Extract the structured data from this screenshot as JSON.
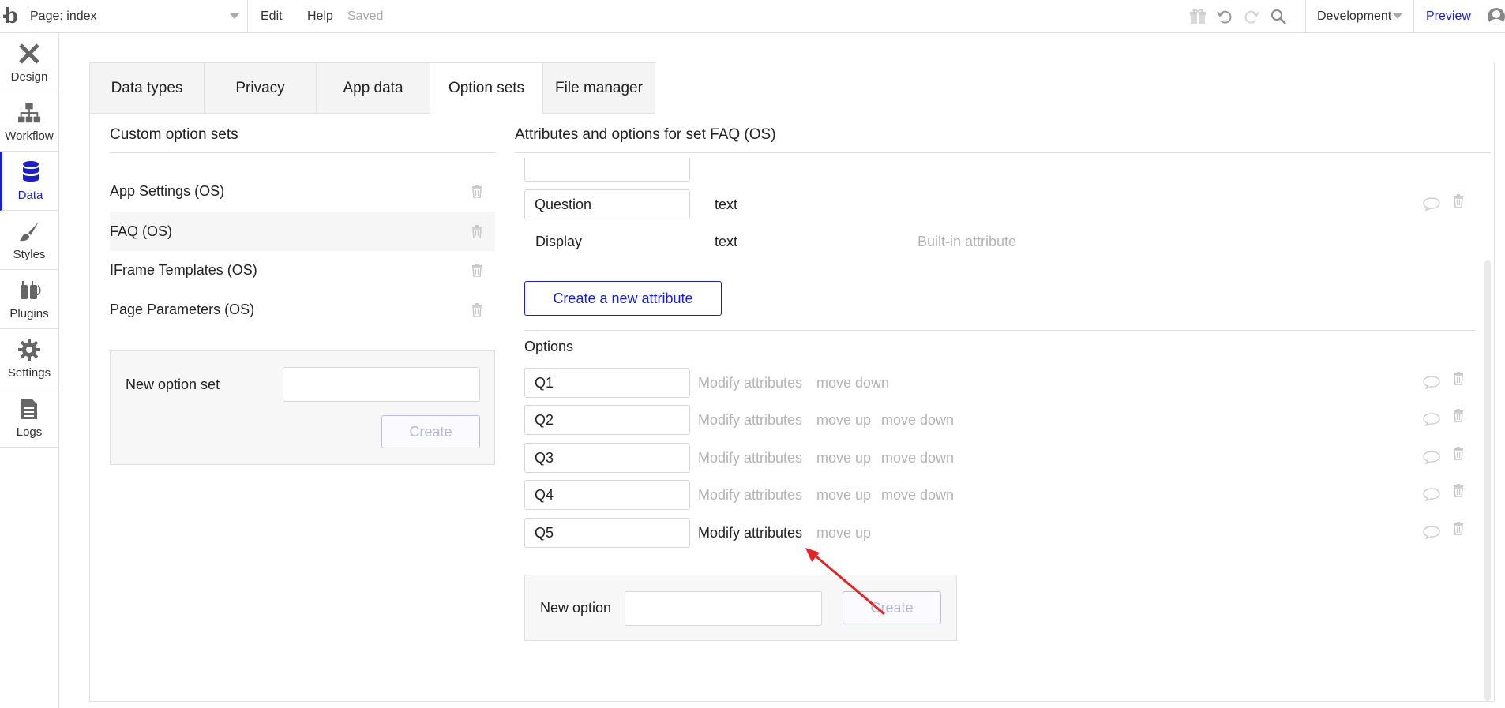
{
  "topbar": {
    "page_label": "Page: index",
    "menu": [
      "Edit",
      "Help"
    ],
    "status": "Saved",
    "environment": "Development",
    "preview": "Preview"
  },
  "sidebar": {
    "items": [
      {
        "label": "Design",
        "icon": "design-icon"
      },
      {
        "label": "Workflow",
        "icon": "workflow-icon"
      },
      {
        "label": "Data",
        "icon": "database-icon",
        "active": true
      },
      {
        "label": "Styles",
        "icon": "brush-icon"
      },
      {
        "label": "Plugins",
        "icon": "plug-icon"
      },
      {
        "label": "Settings",
        "icon": "gear-icon"
      },
      {
        "label": "Logs",
        "icon": "document-icon"
      }
    ]
  },
  "tabs": [
    "Data types",
    "Privacy",
    "App data",
    "Option sets",
    "File manager"
  ],
  "active_tab": "Option sets",
  "left": {
    "title": "Custom option sets",
    "sets": [
      "App Settings (OS)",
      "FAQ (OS)",
      "IFrame Templates (OS)",
      "Page Parameters (OS)"
    ],
    "selected": "FAQ (OS)",
    "new_label": "New option set",
    "create": "Create"
  },
  "right": {
    "title": "Attributes and options for set FAQ (OS)",
    "attributes": [
      {
        "name": "Question",
        "type": "text",
        "note": ""
      },
      {
        "name": "Display",
        "type": "text",
        "note": "Built-in attribute"
      }
    ],
    "create_attribute": "Create a new attribute",
    "options_title": "Options",
    "options": [
      {
        "name": "Q1",
        "modify": "Modify attributes",
        "up": "",
        "down": "move down"
      },
      {
        "name": "Q2",
        "modify": "Modify attributes",
        "up": "move up",
        "down": "move down"
      },
      {
        "name": "Q3",
        "modify": "Modify attributes",
        "up": "move up",
        "down": "move down"
      },
      {
        "name": "Q4",
        "modify": "Modify attributes",
        "up": "move up",
        "down": "move down"
      },
      {
        "name": "Q5",
        "modify": "Modify attributes",
        "up": "move up",
        "down": ""
      }
    ],
    "new_option_label": "New option",
    "create": "Create"
  },
  "colors": {
    "accent": "#1a1fc8",
    "muted": "#b4b4b4",
    "annotation_arrow": "#e52424"
  }
}
